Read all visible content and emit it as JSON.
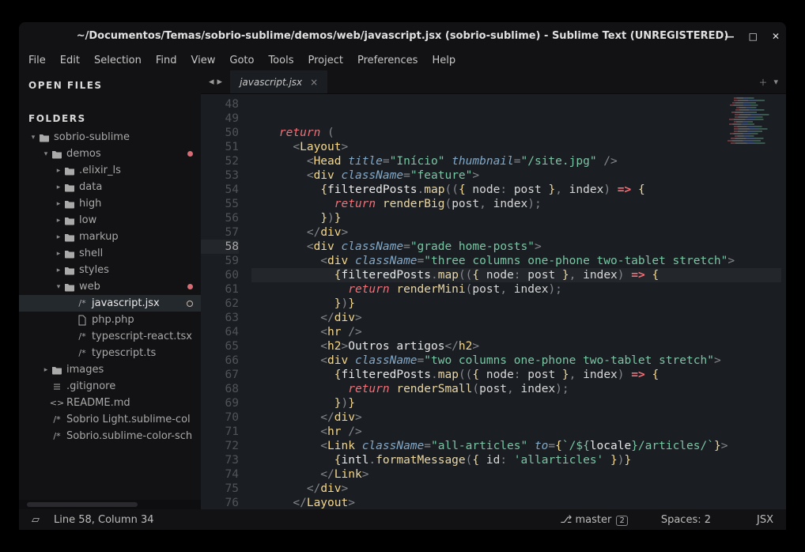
{
  "title": "~/Documentos/Temas/sobrio-sublime/demos/web/javascript.jsx (sobrio-sublime) - Sublime Text (UNREGISTERED)",
  "winbtns": {
    "min": "—",
    "max": "□",
    "close": "✕"
  },
  "menu": [
    "File",
    "Edit",
    "Selection",
    "Find",
    "View",
    "Goto",
    "Tools",
    "Project",
    "Preferences",
    "Help"
  ],
  "sidebar": {
    "open_files_header": "OPEN FILES",
    "folders_header": "FOLDERS"
  },
  "tree": [
    {
      "depth": 0,
      "twisty": "▾",
      "icon": "folder",
      "label": "sobrio-sublime",
      "dot": false
    },
    {
      "depth": 1,
      "twisty": "▾",
      "icon": "folder",
      "label": "demos",
      "dot": true
    },
    {
      "depth": 2,
      "twisty": "▸",
      "icon": "folder",
      "label": ".elixir_ls"
    },
    {
      "depth": 2,
      "twisty": "▸",
      "icon": "folder",
      "label": "data"
    },
    {
      "depth": 2,
      "twisty": "▸",
      "icon": "folder",
      "label": "high"
    },
    {
      "depth": 2,
      "twisty": "▸",
      "icon": "folder",
      "label": "low"
    },
    {
      "depth": 2,
      "twisty": "▸",
      "icon": "folder",
      "label": "markup"
    },
    {
      "depth": 2,
      "twisty": "▸",
      "icon": "folder",
      "label": "shell"
    },
    {
      "depth": 2,
      "twisty": "▸",
      "icon": "folder",
      "label": "styles"
    },
    {
      "depth": 2,
      "twisty": "▾",
      "icon": "folder",
      "label": "web",
      "dot": true
    },
    {
      "depth": 3,
      "twisty": "",
      "icon": "code",
      "label": "javascript.jsx",
      "selected": true,
      "ring": true
    },
    {
      "depth": 3,
      "twisty": "",
      "icon": "file",
      "label": "php.php"
    },
    {
      "depth": 3,
      "twisty": "",
      "icon": "code",
      "label": "typescript-react.tsx"
    },
    {
      "depth": 3,
      "twisty": "",
      "icon": "code",
      "label": "typescript.ts"
    },
    {
      "depth": 1,
      "twisty": "▸",
      "icon": "folder",
      "label": "images"
    },
    {
      "depth": 1,
      "twisty": "",
      "icon": "settings",
      "label": ".gitignore"
    },
    {
      "depth": 1,
      "twisty": "",
      "icon": "md",
      "label": "README.md"
    },
    {
      "depth": 1,
      "twisty": "",
      "icon": "code",
      "label": "Sobrio Light.sublime-col"
    },
    {
      "depth": 1,
      "twisty": "",
      "icon": "code",
      "label": "Sobrio.sublime-color-sch"
    }
  ],
  "tab": {
    "name": "javascript.jsx"
  },
  "line_start": 48,
  "current_line": 58,
  "code": [
    [
      [
        "s-p",
        "    "
      ],
      [
        "s-k",
        "return"
      ],
      [
        "s-p",
        " ("
      ]
    ],
    [
      [
        "s-p",
        "      <"
      ],
      [
        "s-t",
        "Layout"
      ],
      [
        "s-p",
        ">"
      ]
    ],
    [
      [
        "s-p",
        "        <"
      ],
      [
        "s-t",
        "Head"
      ],
      [
        "s-p",
        " "
      ],
      [
        "s-a",
        "title"
      ],
      [
        "s-p",
        "="
      ],
      [
        "s-s",
        "\"Início\""
      ],
      [
        "s-p",
        " "
      ],
      [
        "s-a",
        "thumbnail"
      ],
      [
        "s-p",
        "="
      ],
      [
        "s-s",
        "\"/site.jpg\""
      ],
      [
        "s-p",
        " />"
      ]
    ],
    [
      [
        "s-p",
        "        <"
      ],
      [
        "s-t",
        "div"
      ],
      [
        "s-p",
        " "
      ],
      [
        "s-a",
        "className"
      ],
      [
        "s-p",
        "="
      ],
      [
        "s-s",
        "\"feature\""
      ],
      [
        "s-p",
        ">"
      ]
    ],
    [
      [
        "s-p",
        "          "
      ],
      [
        "s-bc",
        "{"
      ],
      [
        "s-v",
        "filteredPosts"
      ],
      [
        "s-p",
        "."
      ],
      [
        "s-f",
        "map"
      ],
      [
        "s-p",
        "(("
      ],
      [
        "s-bc",
        "{"
      ],
      [
        "s-p",
        " "
      ],
      [
        "s-n",
        "node"
      ],
      [
        "s-p",
        ": "
      ],
      [
        "s-n",
        "post"
      ],
      [
        "s-p",
        " "
      ],
      [
        "s-bc",
        "}"
      ],
      [
        "s-p",
        ", "
      ],
      [
        "s-n",
        "index"
      ],
      [
        "s-p",
        ") "
      ],
      [
        "s-ar",
        "=>"
      ],
      [
        "s-p",
        " "
      ],
      [
        "s-bc",
        "{"
      ]
    ],
    [
      [
        "s-p",
        "            "
      ],
      [
        "s-k",
        "return"
      ],
      [
        "s-p",
        " "
      ],
      [
        "s-f",
        "renderBig"
      ],
      [
        "s-p",
        "("
      ],
      [
        "s-n",
        "post"
      ],
      [
        "s-p",
        ", "
      ],
      [
        "s-n",
        "index"
      ],
      [
        "s-p",
        ");"
      ]
    ],
    [
      [
        "s-p",
        "          "
      ],
      [
        "s-bc",
        "}"
      ],
      [
        "s-p",
        ")"
      ],
      [
        "s-bc",
        "}"
      ]
    ],
    [
      [
        "s-p",
        "        </"
      ],
      [
        "s-t",
        "div"
      ],
      [
        "s-p",
        ">"
      ]
    ],
    [
      [
        "s-p",
        "        <"
      ],
      [
        "s-t",
        "div"
      ],
      [
        "s-p",
        " "
      ],
      [
        "s-a",
        "className"
      ],
      [
        "s-p",
        "="
      ],
      [
        "s-s",
        "\"grade home-posts\""
      ],
      [
        "s-p",
        ">"
      ]
    ],
    [
      [
        "s-p",
        "          <"
      ],
      [
        "s-t",
        "div"
      ],
      [
        "s-p",
        " "
      ],
      [
        "s-a",
        "className"
      ],
      [
        "s-p",
        "="
      ],
      [
        "s-s",
        "\"three columns one-phone two-tablet stretch\""
      ],
      [
        "s-p",
        ">"
      ]
    ],
    [
      [
        "s-p",
        "            "
      ],
      [
        "s-bc",
        "{"
      ],
      [
        "s-v",
        "filteredPosts"
      ],
      [
        "s-p",
        "."
      ],
      [
        "s-f",
        "map"
      ],
      [
        "s-p",
        "(("
      ],
      [
        "s-bc",
        "{"
      ],
      [
        "s-p",
        " "
      ],
      [
        "s-n",
        "node"
      ],
      [
        "s-p",
        ": "
      ],
      [
        "s-n",
        "post"
      ],
      [
        "s-p",
        " "
      ],
      [
        "s-bc",
        "}"
      ],
      [
        "s-p",
        ", "
      ],
      [
        "s-n",
        "index"
      ],
      [
        "s-p",
        ") "
      ],
      [
        "s-ar",
        "=>"
      ],
      [
        "s-p",
        " "
      ],
      [
        "s-bc",
        "{"
      ]
    ],
    [
      [
        "s-p",
        "              "
      ],
      [
        "s-k",
        "return"
      ],
      [
        "s-p",
        " "
      ],
      [
        "s-f",
        "renderMini"
      ],
      [
        "s-p",
        "("
      ],
      [
        "s-n",
        "post"
      ],
      [
        "s-p",
        ", "
      ],
      [
        "s-n",
        "index"
      ],
      [
        "s-p",
        ");"
      ]
    ],
    [
      [
        "s-p",
        "            "
      ],
      [
        "s-bc",
        "}"
      ],
      [
        "s-p",
        ")"
      ],
      [
        "s-bc",
        "}"
      ]
    ],
    [
      [
        "s-p",
        "          </"
      ],
      [
        "s-t",
        "div"
      ],
      [
        "s-p",
        ">"
      ]
    ],
    [
      [
        "s-p",
        "          <"
      ],
      [
        "s-t",
        "hr"
      ],
      [
        "s-p",
        " />"
      ]
    ],
    [
      [
        "s-p",
        "          <"
      ],
      [
        "s-t",
        "h2"
      ],
      [
        "s-p",
        ">"
      ],
      [
        "s-v",
        "Outros artigos"
      ],
      [
        "s-p",
        "</"
      ],
      [
        "s-t",
        "h2"
      ],
      [
        "s-p",
        ">"
      ]
    ],
    [
      [
        "s-p",
        "          <"
      ],
      [
        "s-t",
        "div"
      ],
      [
        "s-p",
        " "
      ],
      [
        "s-a",
        "className"
      ],
      [
        "s-p",
        "="
      ],
      [
        "s-s",
        "\"two columns one-phone two-tablet stretch\""
      ],
      [
        "s-p",
        ">"
      ]
    ],
    [
      [
        "s-p",
        "            "
      ],
      [
        "s-bc",
        "{"
      ],
      [
        "s-v",
        "filteredPosts"
      ],
      [
        "s-p",
        "."
      ],
      [
        "s-f",
        "map"
      ],
      [
        "s-p",
        "(("
      ],
      [
        "s-bc",
        "{"
      ],
      [
        "s-p",
        " "
      ],
      [
        "s-n",
        "node"
      ],
      [
        "s-p",
        ": "
      ],
      [
        "s-n",
        "post"
      ],
      [
        "s-p",
        " "
      ],
      [
        "s-bc",
        "}"
      ],
      [
        "s-p",
        ", "
      ],
      [
        "s-n",
        "index"
      ],
      [
        "s-p",
        ") "
      ],
      [
        "s-ar",
        "=>"
      ],
      [
        "s-p",
        " "
      ],
      [
        "s-bc",
        "{"
      ]
    ],
    [
      [
        "s-p",
        "              "
      ],
      [
        "s-k",
        "return"
      ],
      [
        "s-p",
        " "
      ],
      [
        "s-f",
        "renderSmall"
      ],
      [
        "s-p",
        "("
      ],
      [
        "s-n",
        "post"
      ],
      [
        "s-p",
        ", "
      ],
      [
        "s-n",
        "index"
      ],
      [
        "s-p",
        ");"
      ]
    ],
    [
      [
        "s-p",
        "            "
      ],
      [
        "s-bc",
        "}"
      ],
      [
        "s-p",
        ")"
      ],
      [
        "s-bc",
        "}"
      ]
    ],
    [
      [
        "s-p",
        "          </"
      ],
      [
        "s-t",
        "div"
      ],
      [
        "s-p",
        ">"
      ]
    ],
    [
      [
        "s-p",
        "          <"
      ],
      [
        "s-t",
        "hr"
      ],
      [
        "s-p",
        " />"
      ]
    ],
    [
      [
        "s-p",
        "          <"
      ],
      [
        "s-t",
        "Link"
      ],
      [
        "s-p",
        " "
      ],
      [
        "s-a",
        "className"
      ],
      [
        "s-p",
        "="
      ],
      [
        "s-s",
        "\"all-articles\""
      ],
      [
        "s-p",
        " "
      ],
      [
        "s-a",
        "to"
      ],
      [
        "s-p",
        "="
      ],
      [
        "s-bc",
        "{"
      ],
      [
        "s-s",
        "`/${"
      ],
      [
        "s-v",
        "locale"
      ],
      [
        "s-s",
        "}/articles/`"
      ],
      [
        "s-bc",
        "}"
      ],
      [
        "s-p",
        ">"
      ]
    ],
    [
      [
        "s-p",
        "            "
      ],
      [
        "s-bc",
        "{"
      ],
      [
        "s-v",
        "intl"
      ],
      [
        "s-p",
        "."
      ],
      [
        "s-f",
        "formatMessage"
      ],
      [
        "s-p",
        "("
      ],
      [
        "s-bc",
        "{"
      ],
      [
        "s-p",
        " "
      ],
      [
        "s-n",
        "id"
      ],
      [
        "s-p",
        ": "
      ],
      [
        "s-s",
        "'allarticles'"
      ],
      [
        "s-p",
        " "
      ],
      [
        "s-bc",
        "}"
      ],
      [
        "s-p",
        ")"
      ],
      [
        "s-bc",
        "}"
      ]
    ],
    [
      [
        "s-p",
        "          </"
      ],
      [
        "s-t",
        "Link"
      ],
      [
        "s-p",
        ">"
      ]
    ],
    [
      [
        "s-p",
        "        </"
      ],
      [
        "s-t",
        "div"
      ],
      [
        "s-p",
        ">"
      ]
    ],
    [
      [
        "s-p",
        "      </"
      ],
      [
        "s-t",
        "Layout"
      ],
      [
        "s-p",
        ">"
      ]
    ],
    [
      [
        "s-p",
        "    );"
      ]
    ],
    [
      [
        "s-p",
        "  }"
      ]
    ]
  ],
  "status": {
    "cursor": "Line 58, Column 34",
    "branch": "master",
    "branch_ind": "⎇",
    "branch_count": "2",
    "spaces": "Spaces: 2",
    "syntax": "JSX"
  }
}
